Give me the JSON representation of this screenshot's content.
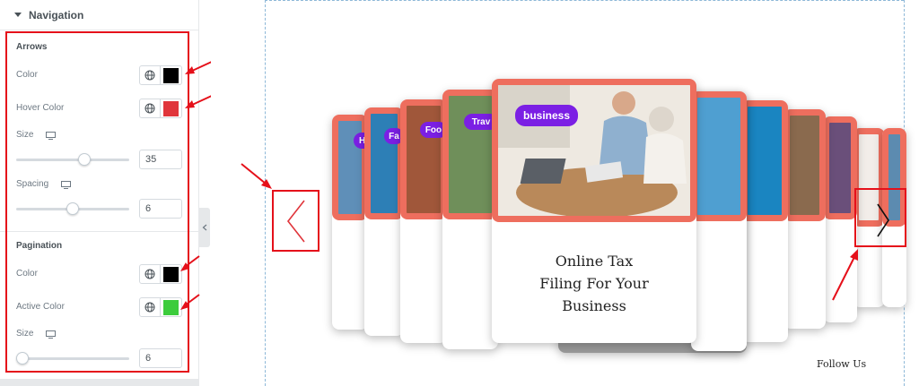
{
  "panel": {
    "section_title": "Navigation",
    "arrows": {
      "heading": "Arrows",
      "color_label": "Color",
      "color_value": "#000000",
      "hover_label": "Hover Color",
      "hover_value": "#e0353b",
      "size_label": "Size",
      "size_value": "35",
      "size_fraction": 0.62,
      "spacing_label": "Spacing",
      "spacing_value": "6",
      "spacing_fraction": 0.5
    },
    "pagination": {
      "heading": "Pagination",
      "color_label": "Color",
      "color_value": "#000000",
      "active_label": "Active Color",
      "active_value": "#3ccc3c",
      "size_label": "Size",
      "size_value": "6",
      "size_fraction": 0.0
    }
  },
  "preview": {
    "active_card": {
      "badge": "business",
      "title_lines": [
        "Online Tax",
        "Filing For Your",
        "Business"
      ]
    },
    "side_chips": [
      "Hi",
      "Fa",
      "Foo",
      "Trav"
    ],
    "follow_text": "Follow Us",
    "accent": "#ee6e5e",
    "chip_color": "#7b1fe4"
  }
}
